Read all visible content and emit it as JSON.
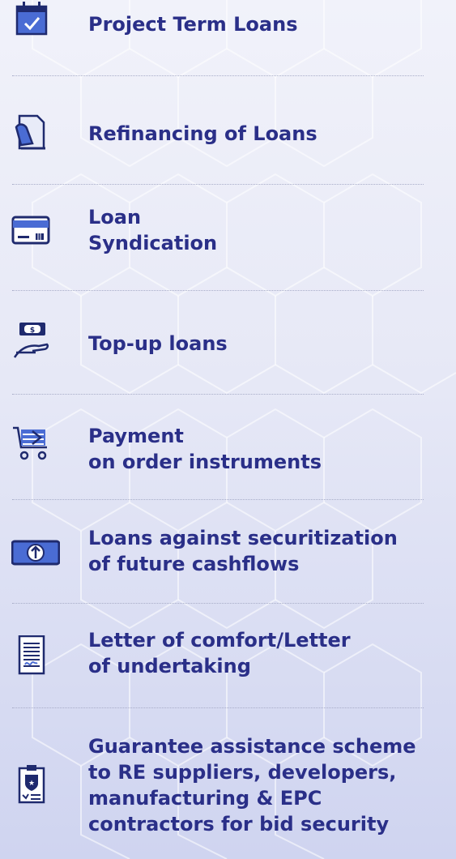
{
  "items": [
    {
      "label": "Project Term Loans",
      "icon": "calendar-check-icon"
    },
    {
      "label": "Refinancing of Loans",
      "icon": "hand-document-icon"
    },
    {
      "label": "Loan\nSyndication",
      "icon": "credit-card-icon"
    },
    {
      "label": "Top-up loans",
      "icon": "hand-cash-icon"
    },
    {
      "label": "Payment\non order instruments",
      "icon": "shopping-cart-icon"
    },
    {
      "label": "Loans against securitization\nof future cashflows",
      "icon": "banknote-arrow-icon"
    },
    {
      "label": "Letter of comfort/Letter\nof undertaking",
      "icon": "document-signature-icon"
    },
    {
      "label": "Guarantee assistance scheme\nto RE suppliers, developers,\nmanufacturing & EPC\ncontractors for bid security",
      "icon": "clipboard-badge-icon"
    }
  ],
  "colors": {
    "text": "#2a2f88",
    "icon": "#1f2a6e",
    "accent": "#4a6cd4",
    "divider": "#a8adc8"
  }
}
